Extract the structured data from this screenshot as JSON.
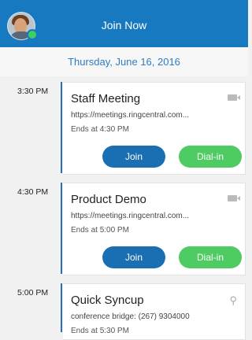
{
  "header": {
    "title": "Join Now",
    "avatar_status_color": "#3ecf5f"
  },
  "date": "Thursday, June 16, 2016",
  "meetings": [
    {
      "time": "3:30 PM",
      "title": "Staff Meeting",
      "detail": "https://meetings.ringcentral.com...",
      "ends": "Ends at 4:30 PM",
      "icon": "video-camera-icon",
      "join_label": "Join",
      "dial_label": "Dial-in"
    },
    {
      "time": "4:30 PM",
      "title": "Product Demo",
      "detail": "https://meetings.ringcentral.com...",
      "ends": "Ends at 5:00 PM",
      "icon": "video-camera-icon",
      "join_label": "Join",
      "dial_label": "Dial-in"
    },
    {
      "time": "5:00 PM",
      "title": "Quick Syncup",
      "detail": "conference bridge: (267) 9304000",
      "ends": "Ends at 5:30 PM",
      "icon": "conference-phone-icon"
    }
  ],
  "colors": {
    "header_bg": "#1779bf",
    "join_button": "#1a6fb2",
    "dial_button": "#4ecb62",
    "timeline": "#2d6fb5",
    "date_text": "#2f7cc0"
  }
}
